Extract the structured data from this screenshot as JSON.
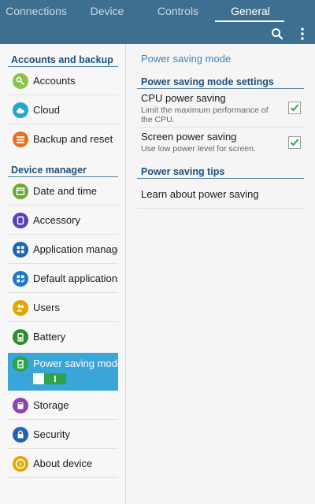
{
  "tabs": [
    "Connections",
    "Device",
    "Controls",
    "General"
  ],
  "active_tab": "General",
  "colors": {
    "topbar": "#3f6f90",
    "accent": "#3aa5d7",
    "header": "#1f4f78",
    "check": "#2da44a"
  },
  "top_icons": [
    "search-icon",
    "more-vert-icon"
  ],
  "sidebar": {
    "sections": [
      {
        "title": "Accounts and backup",
        "items": [
          {
            "label": "Accounts",
            "icon": "key-icon",
            "color": "#8bc34a"
          },
          {
            "label": "Cloud",
            "icon": "cloud-icon",
            "color": "#26a6d1"
          },
          {
            "label": "Backup and reset",
            "icon": "backup-icon",
            "color": "#ef6c1b"
          }
        ]
      },
      {
        "title": "Device manager",
        "items": [
          {
            "label": "Date and time",
            "icon": "calendar-icon",
            "color": "#6aa832"
          },
          {
            "label": "Accessory",
            "icon": "accessory-icon",
            "color": "#5b3fb5"
          },
          {
            "label": "Application manager",
            "icon": "apps-grid-icon",
            "color": "#1e63b5"
          },
          {
            "label": "Default applications",
            "icon": "default-apps-icon",
            "color": "#1e7ac9"
          },
          {
            "label": "Users",
            "icon": "users-icon",
            "color": "#e0a800"
          },
          {
            "label": "Battery",
            "icon": "battery-icon",
            "color": "#2e8b2e"
          },
          {
            "label": "Power saving mode",
            "icon": "power-saving-icon",
            "color": "#2da44a",
            "selected": true,
            "toggle_on": true
          },
          {
            "label": "Storage",
            "icon": "storage-icon",
            "color": "#8e44ad"
          },
          {
            "label": "Security",
            "icon": "lock-icon",
            "color": "#1e63b5"
          },
          {
            "label": "About device",
            "icon": "info-icon",
            "color": "#e0a800"
          }
        ]
      }
    ]
  },
  "main": {
    "crumb": "Power saving mode",
    "settings_header": "Power saving mode settings",
    "settings": [
      {
        "title": "CPU power saving",
        "subtitle": "Limit the maximum performance of the CPU.",
        "checked": true
      },
      {
        "title": "Screen power saving",
        "subtitle": "Use low power level for screen.",
        "checked": true
      }
    ],
    "tips_header": "Power saving tips",
    "learn_label": "Learn about power saving"
  }
}
